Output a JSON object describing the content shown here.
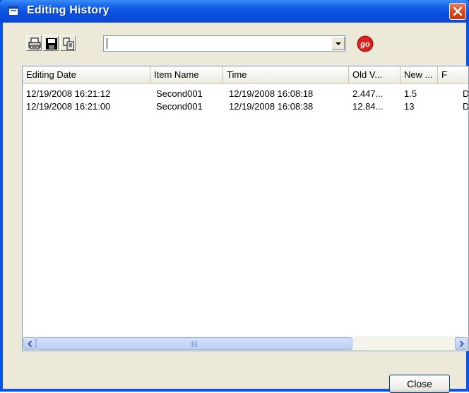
{
  "window": {
    "title": "Editing History",
    "icon": "window-app-icon",
    "close_icon": "close-icon"
  },
  "toolbar": {
    "buttons": [
      {
        "name": "print-button",
        "icon": "printer-icon"
      },
      {
        "name": "save-button",
        "icon": "floppy-disk-icon"
      },
      {
        "name": "copy-button",
        "icon": "copy-icon"
      }
    ],
    "combo_value": "",
    "go_label": "go"
  },
  "list": {
    "columns": [
      "Editing Date",
      "Item Name",
      "Time",
      "Old V...",
      "New ...",
      "F"
    ],
    "rows": [
      [
        "12/19/2008 16:21:12",
        "Second001",
        "12/19/2008 16:08:18",
        "2.447...",
        "1.5",
        "D"
      ],
      [
        "12/19/2008 16:21:00",
        "Second001",
        "12/19/2008 16:08:38",
        "12.84...",
        "13",
        "D"
      ]
    ]
  },
  "scrollbar": {
    "left_icon": "arrow-left-icon",
    "right_icon": "arrow-right-icon"
  },
  "footer": {
    "close_label": "Close"
  },
  "colors": {
    "titlebar": "#0a4fe0",
    "dialog_bg": "#ece9d8",
    "close_red": "#d6471c"
  }
}
